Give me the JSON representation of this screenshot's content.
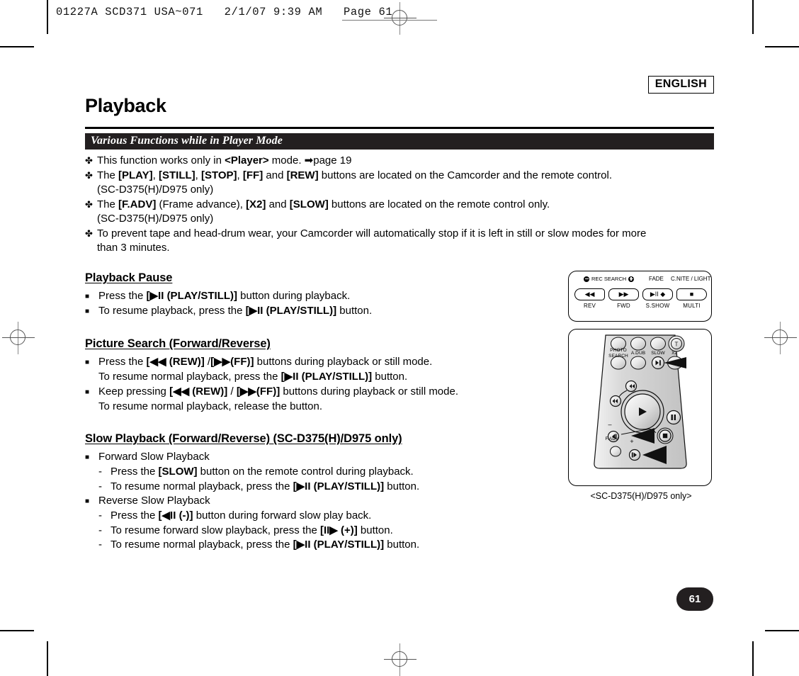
{
  "print_header": {
    "text": "01227A SCD371 USA~071   2/1/07 9:39 AM   Page 61"
  },
  "language_badge": "ENGLISH",
  "chapter_title": "Playback",
  "section_bar_title": "Various Functions while in Player Mode",
  "intro_bullets": [
    {
      "marker": "✤",
      "parts": [
        {
          "t": "This function works only in ",
          "b": false
        },
        {
          "t": "<Player>",
          "b": true
        },
        {
          "t": " mode. ",
          "b": false
        },
        {
          "t": "➡page 19",
          "b": false
        }
      ],
      "continuation": null
    },
    {
      "marker": "✤",
      "parts": [
        {
          "t": "The ",
          "b": false
        },
        {
          "t": "[PLAY]",
          "b": true
        },
        {
          "t": ", ",
          "b": false
        },
        {
          "t": "[STILL]",
          "b": true
        },
        {
          "t": ", ",
          "b": false
        },
        {
          "t": "[STOP]",
          "b": true
        },
        {
          "t": ", ",
          "b": false
        },
        {
          "t": "[FF]",
          "b": true
        },
        {
          "t": " and ",
          "b": false
        },
        {
          "t": "[REW]",
          "b": true
        },
        {
          "t": " buttons are located on the Camcorder and the remote control.",
          "b": false
        }
      ],
      "continuation": "(SC-D375(H)/D975 only)"
    },
    {
      "marker": "✤",
      "parts": [
        {
          "t": "The ",
          "b": false
        },
        {
          "t": "[F.ADV]",
          "b": true
        },
        {
          "t": " (Frame advance), ",
          "b": false
        },
        {
          "t": "[X2]",
          "b": true
        },
        {
          "t": " and ",
          "b": false
        },
        {
          "t": "[SLOW]",
          "b": true
        },
        {
          "t": " buttons are located on the remote control only.",
          "b": false
        }
      ],
      "continuation": "(SC-D375(H)/D975 only)"
    },
    {
      "marker": "✤",
      "parts": [
        {
          "t": "To prevent tape and head-drum wear, your Camcorder will automatically stop if it is left in still or slow modes for more",
          "b": false
        }
      ],
      "continuation": "than 3 minutes."
    }
  ],
  "sections": [
    {
      "heading": "Playback Pause",
      "items": [
        {
          "marker": "■",
          "parts": [
            {
              "t": "Press the ",
              "b": false
            },
            {
              "t": "[▶II (PLAY/STILL)]",
              "b": true
            },
            {
              "t": " button during playback.",
              "b": false
            }
          ],
          "sub": null,
          "dashes": []
        },
        {
          "marker": "■",
          "parts": [
            {
              "t": "To resume playback, press the ",
              "b": false
            },
            {
              "t": "[▶II (PLAY/STILL)]",
              "b": true
            },
            {
              "t": " button.",
              "b": false
            }
          ],
          "sub": null,
          "dashes": []
        }
      ]
    },
    {
      "heading": "Picture Search (Forward/Reverse)",
      "items": [
        {
          "marker": "■",
          "parts": [
            {
              "t": "Press the ",
              "b": false
            },
            {
              "t": "[◀◀ (REW)]",
              "b": true
            },
            {
              "t": " /",
              "b": false
            },
            {
              "t": "[▶▶(FF)]",
              "b": true
            },
            {
              "t": " buttons during playback or still mode.",
              "b": false
            }
          ],
          "sub": [
            {
              "t": "To resume normal playback, press the ",
              "b": false
            },
            {
              "t": "[▶II (PLAY/STILL)]",
              "b": true
            },
            {
              "t": " button.",
              "b": false
            }
          ],
          "dashes": []
        },
        {
          "marker": "■",
          "parts": [
            {
              "t": "Keep pressing ",
              "b": false
            },
            {
              "t": "[◀◀ (REW)]",
              "b": true
            },
            {
              "t": " / ",
              "b": false
            },
            {
              "t": "[▶▶(FF)]",
              "b": true
            },
            {
              "t": " buttons during playback or still mode.",
              "b": false
            }
          ],
          "sub": [
            {
              "t": "To resume normal playback, release the button.",
              "b": false
            }
          ],
          "dashes": []
        }
      ]
    },
    {
      "heading": "Slow Playback (Forward/Reverse) (SC-D375(H)/D975 only)",
      "items": [
        {
          "marker": "■",
          "parts": [
            {
              "t": "Forward Slow Playback",
              "b": false
            }
          ],
          "sub": null,
          "dashes": [
            {
              "marker": "-",
              "parts": [
                {
                  "t": "Press the ",
                  "b": false
                },
                {
                  "t": "[SLOW]",
                  "b": true
                },
                {
                  "t": " button on the remote control during playback.",
                  "b": false
                }
              ]
            },
            {
              "marker": "-",
              "parts": [
                {
                  "t": "To resume normal playback, press the ",
                  "b": false
                },
                {
                  "t": "[▶II (PLAY/STILL)]",
                  "b": true
                },
                {
                  "t": " button.",
                  "b": false
                }
              ]
            }
          ]
        },
        {
          "marker": "■",
          "parts": [
            {
              "t": "Reverse Slow Playback",
              "b": false
            }
          ],
          "sub": null,
          "dashes": [
            {
              "marker": "-",
              "parts": [
                {
                  "t": "Press the ",
                  "b": false
                },
                {
                  "t": "[◀II (-)]",
                  "b": true
                },
                {
                  "t": " button during forward slow play back.",
                  "b": false
                }
              ]
            },
            {
              "marker": "-",
              "parts": [
                {
                  "t": "To resume forward slow playback, press the ",
                  "b": false
                },
                {
                  "t": "[II▶ (+)]",
                  "b": true
                },
                {
                  "t": " button.",
                  "b": false
                }
              ]
            },
            {
              "marker": "-",
              "parts": [
                {
                  "t": "To resume normal playback, press the ",
                  "b": false
                },
                {
                  "t": "[▶II (PLAY/STILL)]",
                  "b": true
                },
                {
                  "t": " button.",
                  "b": false
                }
              ]
            }
          ]
        }
      ]
    }
  ],
  "camcorder_panel": {
    "top_labels": {
      "rec_search": "REC SEARCH",
      "fade": "FADE",
      "cnite_light": "C.NITE / LIGHT"
    },
    "buttons": [
      {
        "glyph": "◀◀",
        "label": "REV"
      },
      {
        "glyph": "▶▶",
        "label": "FWD"
      },
      {
        "glyph": "▶II ◆",
        "label": "S.SHOW"
      },
      {
        "glyph": "■",
        "label": "MULTI"
      }
    ]
  },
  "remote": {
    "labels": {
      "photo_search": "PHOTO\nSEARCH",
      "adub": "A.DUB",
      "slow": "SLOW",
      "x2": "X2",
      "t": "T",
      "fadv": "F.ADV",
      "minus": "–",
      "plus": "+"
    },
    "caption": "<SC-D375(H)/D975 only>"
  },
  "page_number": "61",
  "colors": {
    "ink": "#231f20",
    "paper": "#ffffff",
    "mark_gray": "#555555"
  }
}
